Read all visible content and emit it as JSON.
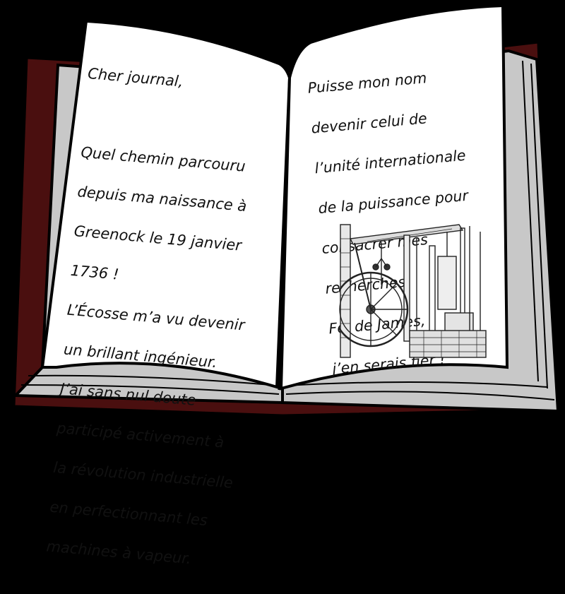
{
  "diary": {
    "left_page": {
      "greeting": "Cher journal,",
      "lines": [
        "Quel chemin parcouru",
        "depuis ma naissance à",
        "Greenock le 19 janvier",
        " 1736 !",
        "L’Écosse m’a vu devenir",
        "un brillant ingénieur.",
        "J’ai sans nul doute",
        "participé activement à",
        "la révolution industrielle",
        "en perfectionnant les",
        "machines à vapeur."
      ]
    },
    "right_page": {
      "lines": [
        "Puisse mon nom",
        "devenir celui de",
        "l’unité internationale",
        "de la puissance pour",
        "consacrer mes",
        "recherches.",
        "Foi de James,",
        "j’en serais fier !"
      ]
    }
  },
  "colors": {
    "background": "#000000",
    "page": "#ffffff",
    "page_edges": "#c8c8c8",
    "cover": "#4a0f0f"
  },
  "illustration": {
    "name": "steam-engine-engraving"
  }
}
